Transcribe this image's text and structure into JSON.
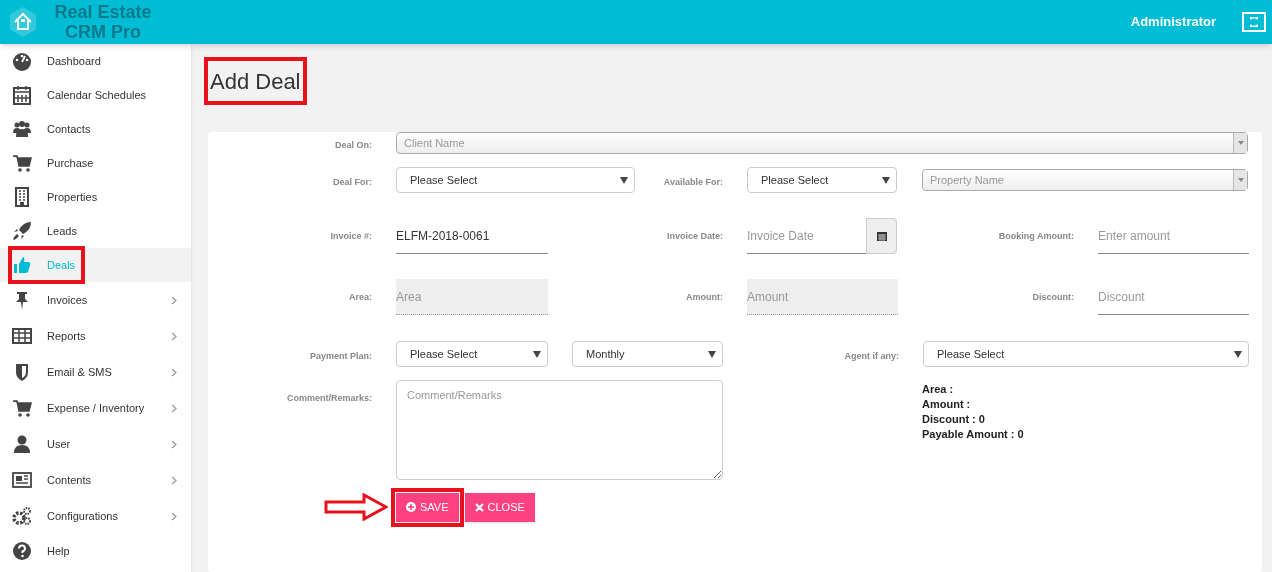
{
  "header": {
    "logo": "Real Estate CRM Pro",
    "user": "Administrator"
  },
  "sidebar": {
    "items": [
      {
        "label": "Dashboard",
        "selected": false,
        "has_submenu": false,
        "highlighted": false
      },
      {
        "label": "Calendar Schedules",
        "selected": false,
        "has_submenu": false,
        "highlighted": false
      },
      {
        "label": "Contacts",
        "selected": false,
        "has_submenu": false,
        "highlighted": false
      },
      {
        "label": "Purchase",
        "selected": false,
        "has_submenu": false,
        "highlighted": false
      },
      {
        "label": "Properties",
        "selected": false,
        "has_submenu": false,
        "highlighted": false
      },
      {
        "label": "Leads",
        "selected": false,
        "has_submenu": false,
        "highlighted": false
      },
      {
        "label": "Deals",
        "selected": true,
        "has_submenu": false,
        "highlighted": true
      },
      {
        "label": "Invoices",
        "selected": false,
        "has_submenu": true,
        "highlighted": false
      },
      {
        "label": "Reports",
        "selected": false,
        "has_submenu": true,
        "highlighted": false
      },
      {
        "label": "Email & SMS",
        "selected": false,
        "has_submenu": true,
        "highlighted": false
      },
      {
        "label": "Expense / Inventory",
        "selected": false,
        "has_submenu": true,
        "highlighted": false
      },
      {
        "label": "User",
        "selected": false,
        "has_submenu": true,
        "highlighted": false
      },
      {
        "label": "Contents",
        "selected": false,
        "has_submenu": true,
        "highlighted": false
      },
      {
        "label": "Configurations",
        "selected": false,
        "has_submenu": true,
        "highlighted": false
      },
      {
        "label": "Help",
        "selected": false,
        "has_submenu": false,
        "highlighted": false
      }
    ]
  },
  "page_title": {
    "text": "Add Deal",
    "highlighted": true
  },
  "form": {
    "deal_on": {
      "label": "Deal On:",
      "placeholder": "Client Name"
    },
    "deal_for": {
      "label": "Deal For:",
      "value": "Please Select"
    },
    "available_for": {
      "label": "Available For:",
      "value": "Please Select"
    },
    "property": {
      "placeholder": "Property Name"
    },
    "invoice_no": {
      "label": "Invoice #:",
      "value": "ELFM-2018-0061",
      "disabled": false
    },
    "invoice_date": {
      "label": "Invoice Date:",
      "placeholder": "Invoice Date",
      "disabled": false
    },
    "booking_amount": {
      "label": "Booking Amount:",
      "placeholder": "Enter amount",
      "disabled": false
    },
    "area": {
      "label": "Area:",
      "placeholder": "Area",
      "disabled": true
    },
    "amount": {
      "label": "Amount:",
      "placeholder": "Amount",
      "disabled": true
    },
    "discount": {
      "label": "Discount:",
      "placeholder": "Discount",
      "disabled": false
    },
    "payment_plan": {
      "label": "Payment Plan:",
      "value": "Please Select",
      "frequency": "Monthly"
    },
    "agent": {
      "label": "Agent if any:",
      "value": "Please Select"
    },
    "comment": {
      "label": "Comment/Remarks:",
      "placeholder": "Comment/Remarks"
    },
    "summary": [
      "Area :",
      "Amount :",
      "Discount : 0",
      "Payable Amount : 0"
    ]
  },
  "buttons": [
    {
      "kind": "save",
      "label": "SAVE",
      "highlighted": true,
      "arrow": true
    },
    {
      "kind": "close",
      "label": "CLOSE"
    }
  ]
}
